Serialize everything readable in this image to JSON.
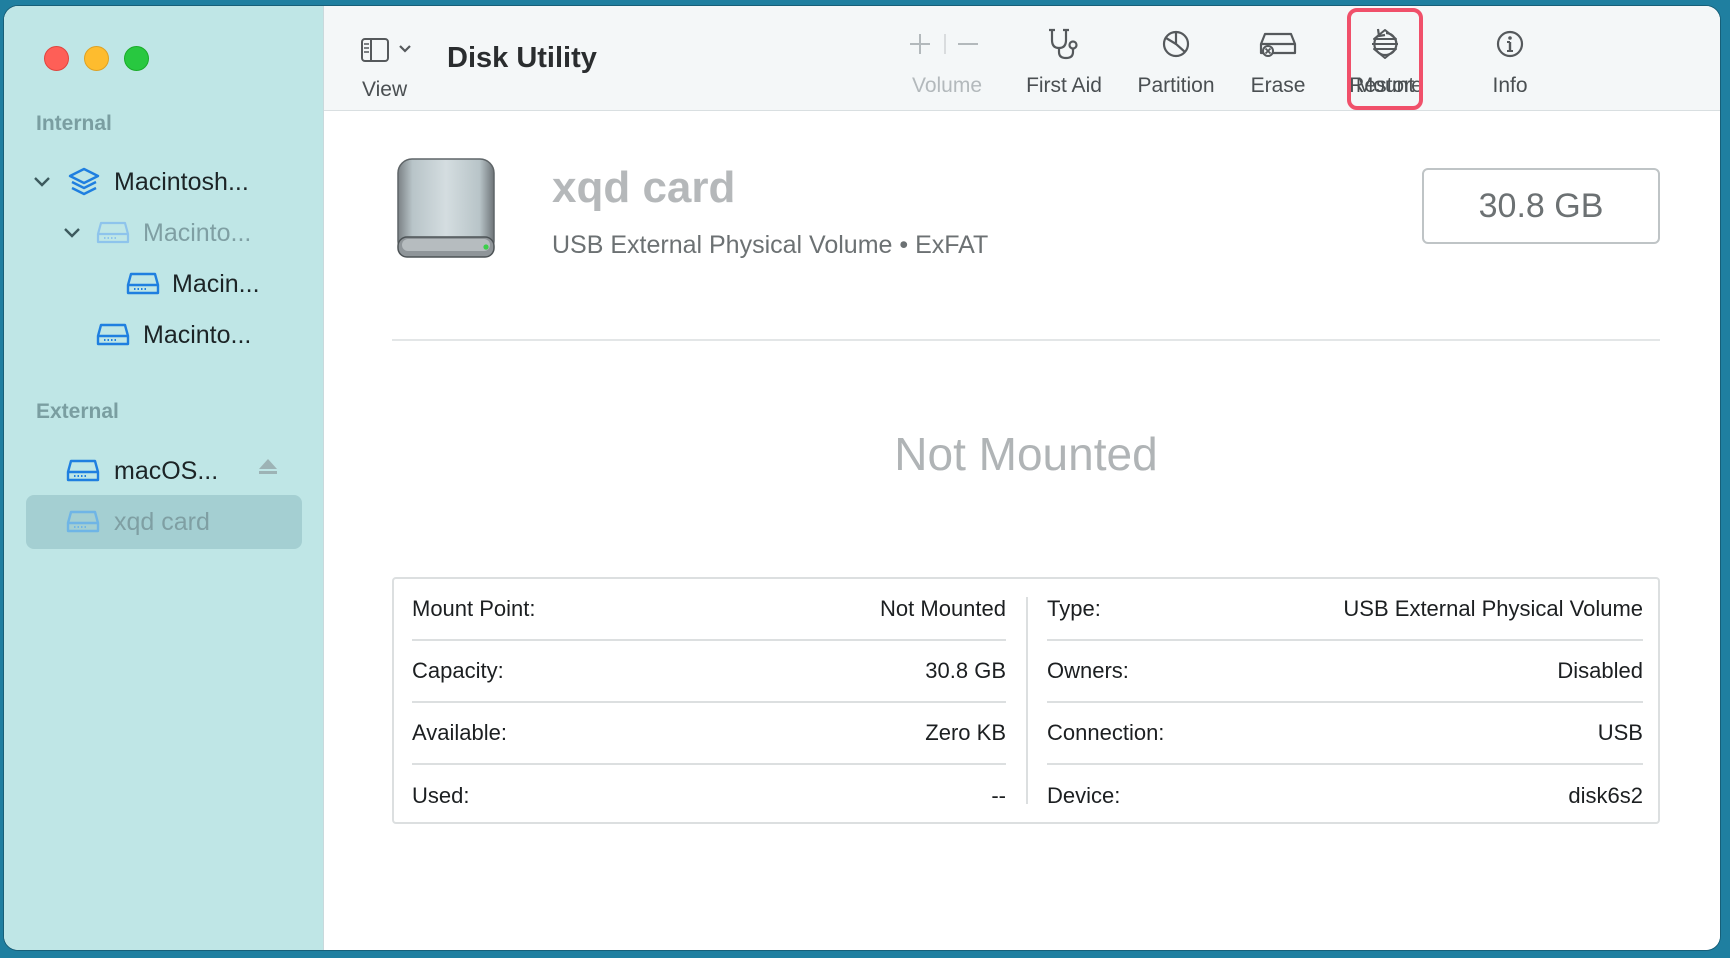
{
  "app": {
    "title": "Disk Utility"
  },
  "toolbar": {
    "view_label": "View",
    "volume_label": "Volume",
    "first_aid_label": "First Aid",
    "partition_label": "Partition",
    "erase_label": "Erase",
    "restore_label": "Restore",
    "mount_label": "Mount",
    "info_label": "Info"
  },
  "sidebar": {
    "internal_label": "Internal",
    "external_label": "External",
    "items": [
      {
        "label": "Macintosh..."
      },
      {
        "label": "Macinto..."
      },
      {
        "label": "Macin..."
      },
      {
        "label": "Macinto..."
      },
      {
        "label": "macOS..."
      },
      {
        "label": "xqd card"
      }
    ]
  },
  "disk": {
    "name": "xqd card",
    "subtitle": "USB External Physical Volume • ExFAT",
    "capacity": "30.8 GB",
    "status": "Not Mounted"
  },
  "details": {
    "left": [
      {
        "label": "Mount Point:",
        "value": "Not Mounted"
      },
      {
        "label": "Capacity:",
        "value": "30.8 GB"
      },
      {
        "label": "Available:",
        "value": "Zero KB"
      },
      {
        "label": "Used:",
        "value": "--"
      }
    ],
    "right": [
      {
        "label": "Type:",
        "value": "USB External Physical Volume"
      },
      {
        "label": "Owners:",
        "value": "Disabled"
      },
      {
        "label": "Connection:",
        "value": "USB"
      },
      {
        "label": "Device:",
        "value": "disk6s2"
      }
    ]
  },
  "colors": {
    "sidebar_bg": "#bfe6e6",
    "accent_blue": "#1f7fe0",
    "highlight": "#f0506a"
  },
  "icons": {
    "view": "sidebar-toggle-icon",
    "volume_add": "plus-icon",
    "volume_remove": "minus-icon",
    "first_aid": "stethoscope-icon",
    "partition": "pie-chart-icon",
    "erase": "eraser-drive-icon",
    "restore": "restore-arrow-icon",
    "mount": "mount-icon",
    "info": "info-icon"
  }
}
